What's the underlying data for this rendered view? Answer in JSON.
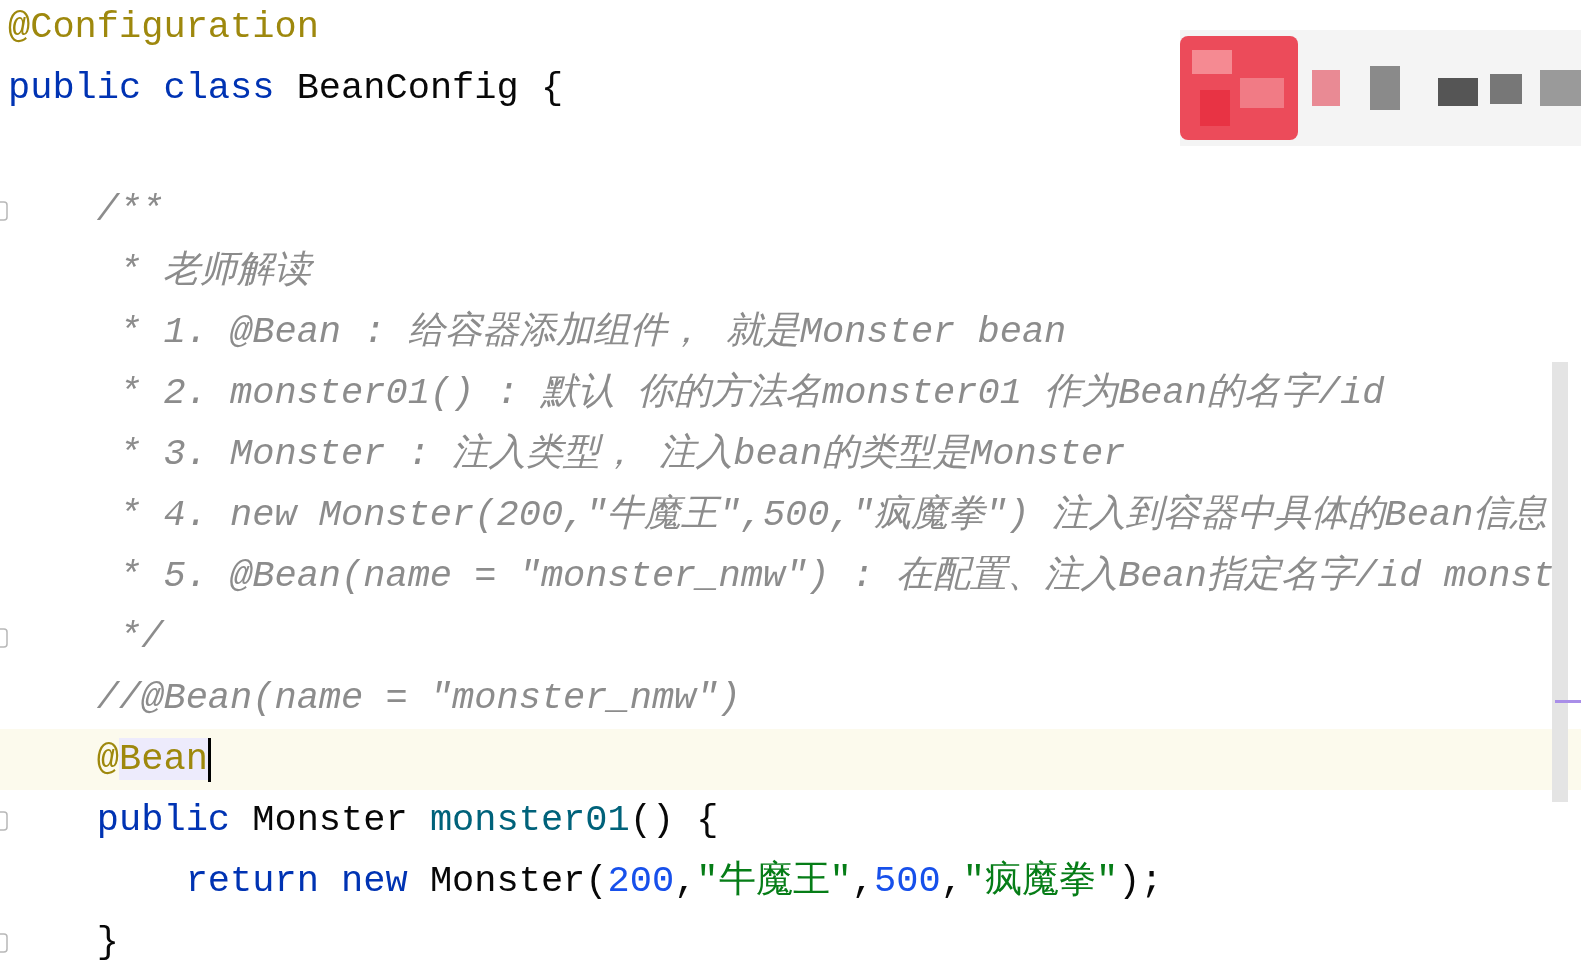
{
  "editor": {
    "lines": [
      {
        "tokens": [
          {
            "text": "@Configuration",
            "kind": "annotation"
          }
        ]
      },
      {
        "tokens": [
          {
            "text": "public class",
            "kind": "keyword"
          },
          {
            "text": " BeanConfig {",
            "kind": "plain"
          }
        ]
      },
      {
        "gap_before": true,
        "fold": true,
        "tokens": [
          {
            "text": "    /**",
            "kind": "comment"
          }
        ]
      },
      {
        "tokens": [
          {
            "text": "     * 老师解读",
            "kind": "comment"
          }
        ]
      },
      {
        "tokens": [
          {
            "text": "     * 1. @Bean : 给容器添加组件， 就是Monster bean",
            "kind": "comment"
          }
        ]
      },
      {
        "tokens": [
          {
            "text": "     * 2. monster01() : 默认 你的方法名monster01 作为Bean的名字/id",
            "kind": "comment"
          }
        ]
      },
      {
        "tokens": [
          {
            "text": "     * 3. Monster : 注入类型， 注入bean的类型是Monster",
            "kind": "comment"
          }
        ]
      },
      {
        "tokens": [
          {
            "text": "     * 4. new Monster(200,\"牛魔王\",500,\"疯魔拳\") 注入到容器中具体的Bean信息",
            "kind": "comment"
          }
        ]
      },
      {
        "tokens": [
          {
            "text": "     * 5. @Bean(name = \"monster_nmw\") : 在配置、注入Bean指定名字/id monst",
            "kind": "comment"
          }
        ]
      },
      {
        "fold": true,
        "tokens": [
          {
            "text": "     */",
            "kind": "comment"
          }
        ]
      },
      {
        "tokens": [
          {
            "text": "    //@Bean(name = \"monster_nmw\")",
            "kind": "comment"
          }
        ]
      },
      {
        "current": true,
        "tokens": [
          {
            "text": "    @",
            "kind": "annotation"
          },
          {
            "text": "Bean",
            "kind": "annotation",
            "highlighted": true
          }
        ]
      },
      {
        "fold": true,
        "tokens": [
          {
            "text": "    public",
            "kind": "keyword"
          },
          {
            "text": " Monster ",
            "kind": "plain"
          },
          {
            "text": "monster01",
            "kind": "method"
          },
          {
            "text": "() {",
            "kind": "plain"
          }
        ]
      },
      {
        "tokens": [
          {
            "text": "        return new",
            "kind": "keyword"
          },
          {
            "text": " Monster(",
            "kind": "plain"
          },
          {
            "text": "200",
            "kind": "number"
          },
          {
            "text": ",",
            "kind": "plain"
          },
          {
            "text": "\"牛魔王\"",
            "kind": "string"
          },
          {
            "text": ",",
            "kind": "plain"
          },
          {
            "text": "500",
            "kind": "number"
          },
          {
            "text": ",",
            "kind": "plain"
          },
          {
            "text": "\"疯魔拳\"",
            "kind": "string"
          },
          {
            "text": ");",
            "kind": "plain"
          }
        ]
      },
      {
        "fold": true,
        "tokens": [
          {
            "text": "    }",
            "kind": "plain"
          }
        ]
      }
    ]
  }
}
